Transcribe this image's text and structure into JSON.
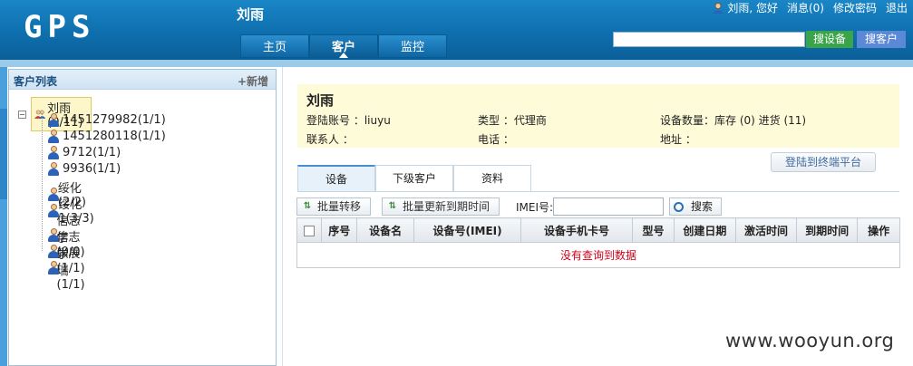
{
  "header": {
    "logo": "GPS",
    "user_title": "刘雨",
    "greeting": "刘雨, 您好",
    "messages": "消息(0)",
    "change_password": "修改密码",
    "logout": "退出",
    "nav": [
      "主页",
      "客户",
      "监控"
    ],
    "active_nav": "客户",
    "search_device": "搜设备",
    "search_customer": "搜客户",
    "colors": {
      "header_bg": "#0e6fae",
      "search_device_bg": "#3aa44a",
      "search_customer_bg": "#5c88d8"
    }
  },
  "sidebar": {
    "title": "客户列表",
    "add": "+新增",
    "root": "刘雨(0/11)",
    "items": [
      "1451279982(1/1)",
      "1451280118(1/1)",
      "9712(1/1)",
      "9936(1/1)",
      "绥化(2/2)",
      "绥化1(3/3)",
      "信志学(0/0)",
      "信志学(1/1)",
      "张展瑞(1/1)"
    ]
  },
  "info": {
    "name": "刘雨",
    "account": "登陆账号 ：liuyu",
    "type": "类型 ：代理商",
    "device_count": "设备数量：库存 (0)  进货 (11)",
    "contact": "联系人 ：",
    "phone": "电话 ：",
    "address": "地址 ："
  },
  "login_terminal": "登陆到终端平台",
  "tabs": [
    "设备",
    "下级客户",
    "资料"
  ],
  "toolbar": {
    "batch_transfer": "批量转移",
    "batch_update": "批量更新到期时间",
    "imei_label": "IMEI号:",
    "search": "搜索"
  },
  "table": {
    "headers": [
      "序号",
      "设备名",
      "设备号(IMEI)",
      "设备手机卡号",
      "型号",
      "创建日期",
      "激活时间",
      "到期时间",
      "操作"
    ],
    "empty_text": "没有查询到数据"
  },
  "watermark": "www.wooyun.org"
}
